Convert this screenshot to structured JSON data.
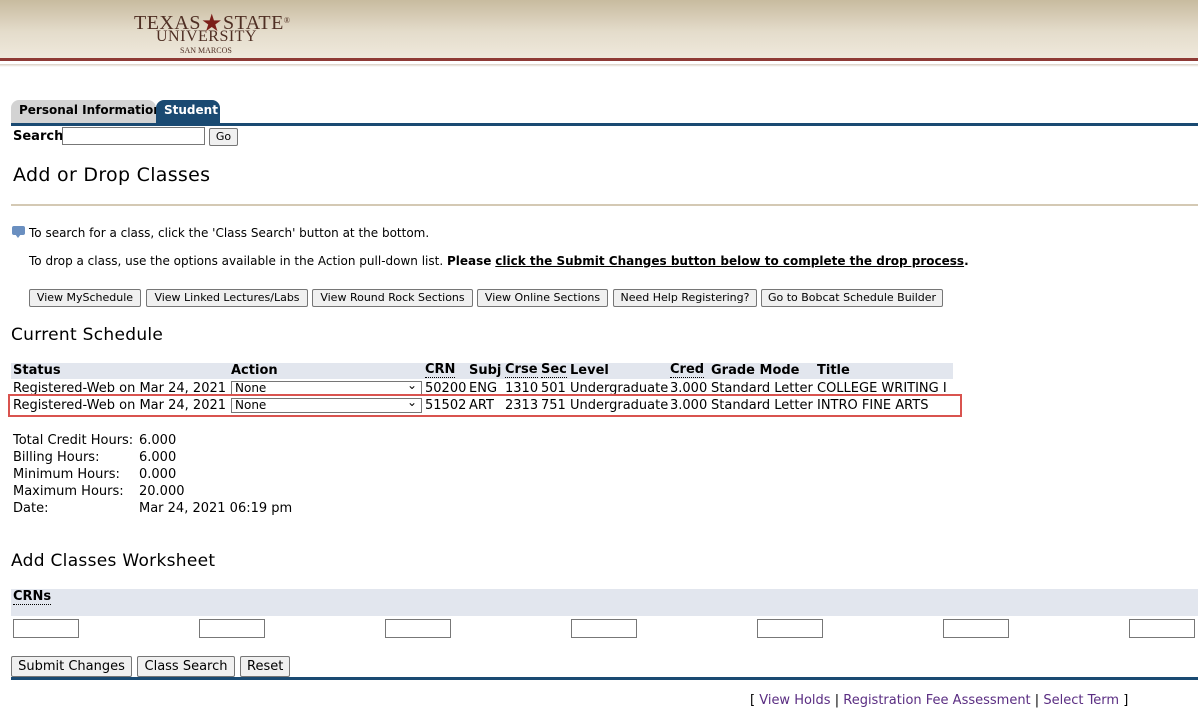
{
  "logo": {
    "line1_left": "TEXAS",
    "line1_right": "STATE",
    "line2": "UNIVERSITY",
    "line3": "SAN MARCOS",
    "reg": "®"
  },
  "tabs": [
    {
      "label": "Personal Information"
    },
    {
      "label": "Student",
      "active": true
    }
  ],
  "search": {
    "label": "Search",
    "value": "",
    "go_label": "Go"
  },
  "page_title": "Add or Drop Classes",
  "info": {
    "line1": "To search for a class, click the 'Class Search' button at the bottom.",
    "line2_plain": "To drop a class, use the options available in the Action pull-down list.",
    "line2_bold": "Please",
    "line2_link": "click the Submit Changes button below to complete the drop process",
    "line2_end": "."
  },
  "action_buttons": [
    "View MySchedule",
    "View Linked Lectures/Labs",
    "View Round Rock Sections",
    "View Online Sections",
    "Need Help Registering?",
    "Go to Bobcat Schedule Builder"
  ],
  "current_schedule": {
    "heading": "Current Schedule",
    "columns": [
      "Status",
      "Action",
      "CRN",
      "Subj",
      "Crse",
      "Sec",
      "Level",
      "Cred",
      "Grade Mode",
      "Title"
    ],
    "rows": [
      {
        "status": "Registered-Web on Mar 24, 2021",
        "action": "None",
        "crn": "50200",
        "subj": "ENG",
        "crse": "1310",
        "sec": "501",
        "level": "Undergraduate",
        "cred": "3.000",
        "grade_mode": "Standard Letter",
        "title": "COLLEGE WRITING I"
      },
      {
        "status": "Registered-Web on Mar 24, 2021",
        "action": "None",
        "crn": "51502",
        "subj": "ART",
        "crse": "2313",
        "sec": "751",
        "level": "Undergraduate",
        "cred": "3.000",
        "grade_mode": "Standard Letter",
        "title": "INTRO FINE ARTS"
      }
    ]
  },
  "totals": [
    {
      "label": "Total Credit Hours:",
      "value": "6.000"
    },
    {
      "label": "Billing Hours:",
      "value": "6.000"
    },
    {
      "label": "Minimum Hours:",
      "value": "0.000"
    },
    {
      "label": "Maximum Hours:",
      "value": "20.000"
    },
    {
      "label": "Date:",
      "value": "Mar 24, 2021 06:19 pm"
    }
  ],
  "worksheet": {
    "heading": "Add Classes Worksheet",
    "crns_label": "CRNs",
    "crn_values": [
      "",
      "",
      "",
      "",
      "",
      "",
      ""
    ]
  },
  "bottom_buttons": [
    "Submit Changes",
    "Class Search",
    "Reset"
  ],
  "footer": {
    "open": "[",
    "links": [
      "View Holds",
      "Registration Fee Assessment",
      "Select Term"
    ],
    "sep": "|",
    "close": "]"
  },
  "colors": {
    "nav_blue": "#1a4a72",
    "maroon": "#8e3a35",
    "header_bg": "#e2e6ee",
    "highlight": "#d9534f",
    "link": "#5a2d82"
  }
}
